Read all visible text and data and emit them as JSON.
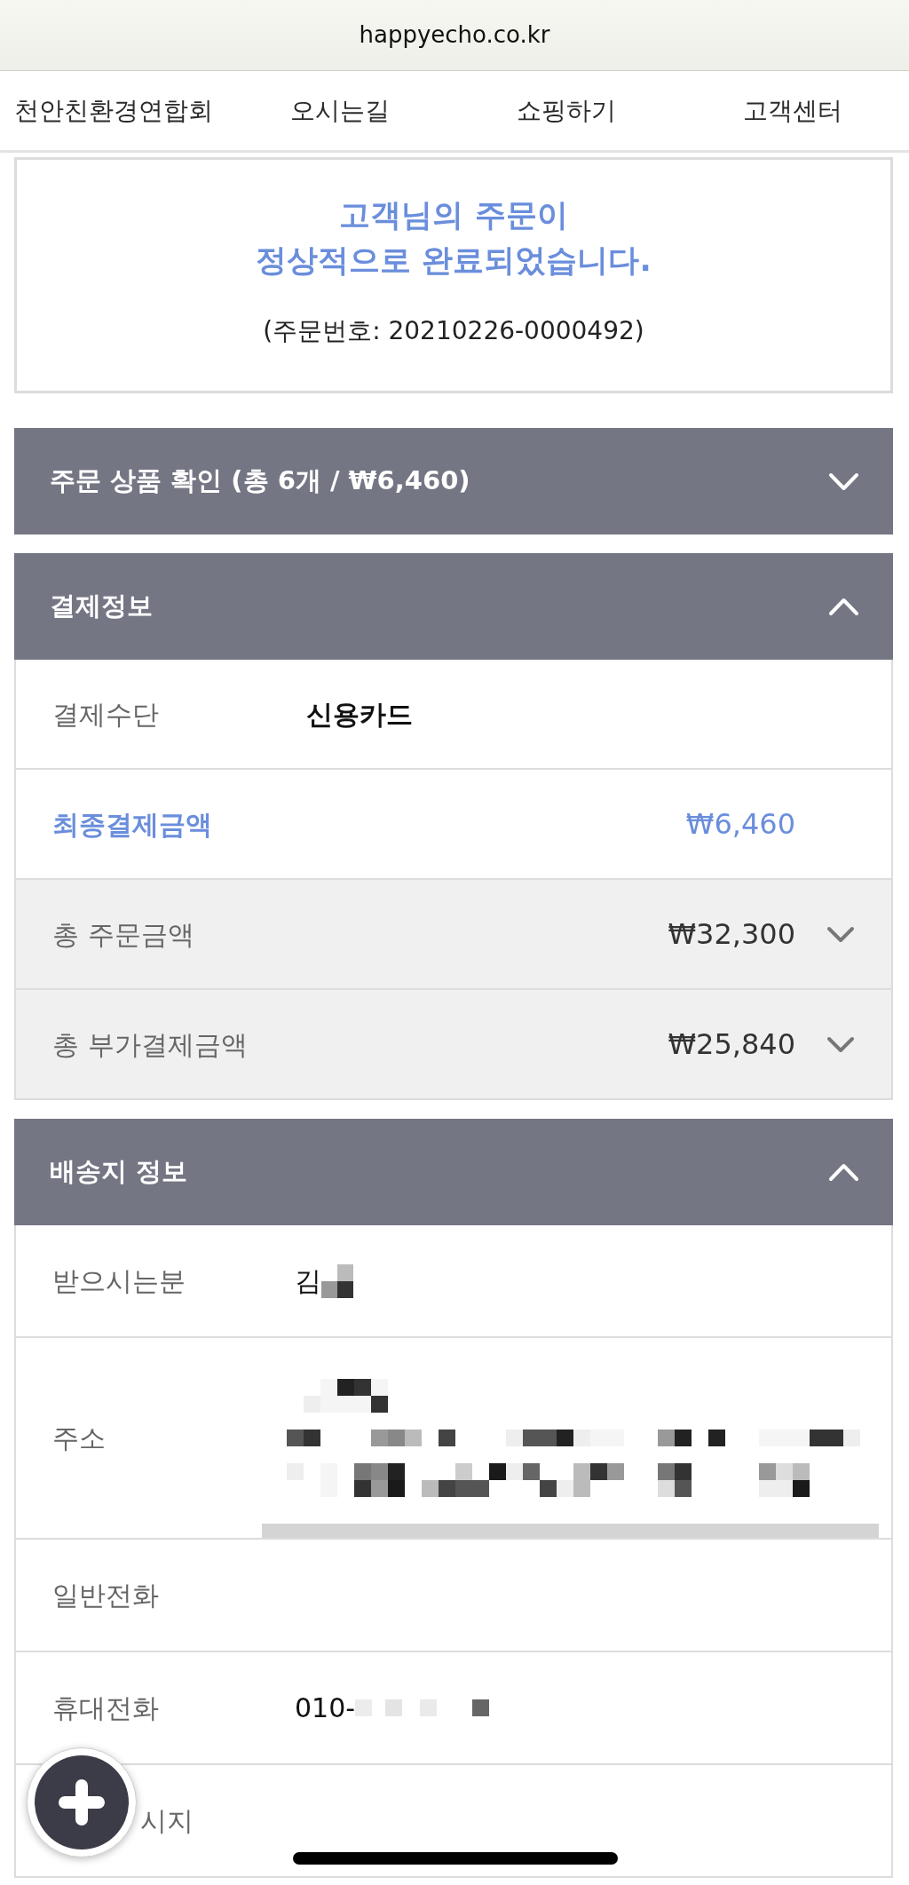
{
  "browser": {
    "url": "happyecho.co.kr"
  },
  "nav": [
    "천안친환경연합회",
    "오시는길",
    "쇼핑하기",
    "고객센터"
  ],
  "order_complete": {
    "message_lines": [
      "고객님의 주문이",
      "정상적으로 완료되었습니다."
    ],
    "order_number": "(주문번호: 20210226-0000492)"
  },
  "sections": [
    {
      "title": "주문 상품 확인 (총 6개 / ₩6,460)",
      "expanded": false
    },
    {
      "title": "결제정보",
      "expanded": true,
      "rows": [
        {
          "kind": "pair",
          "label": "결제수단",
          "value": "신용카드"
        },
        {
          "kind": "total",
          "label": "최종결제금액",
          "value": "₩6,460"
        },
        {
          "kind": "detail",
          "label": "총 주문금액",
          "value": "₩32,300",
          "expanded": false
        },
        {
          "kind": "detail",
          "label": "총 부가결제금액",
          "value": "₩25,840",
          "expanded": false
        }
      ]
    },
    {
      "title": "배송지 정보",
      "expanded": true,
      "rows": [
        {
          "kind": "pixelated",
          "label": "받으시는분",
          "value": "김"
        },
        {
          "kind": "mosaic",
          "label": "주소"
        },
        {
          "kind": "field",
          "label": "일반전화"
        },
        {
          "kind": "speckled",
          "label": "휴대전화",
          "value": "010-"
        },
        {
          "kind": "covered",
          "label": "시지"
        }
      ]
    }
  ]
}
